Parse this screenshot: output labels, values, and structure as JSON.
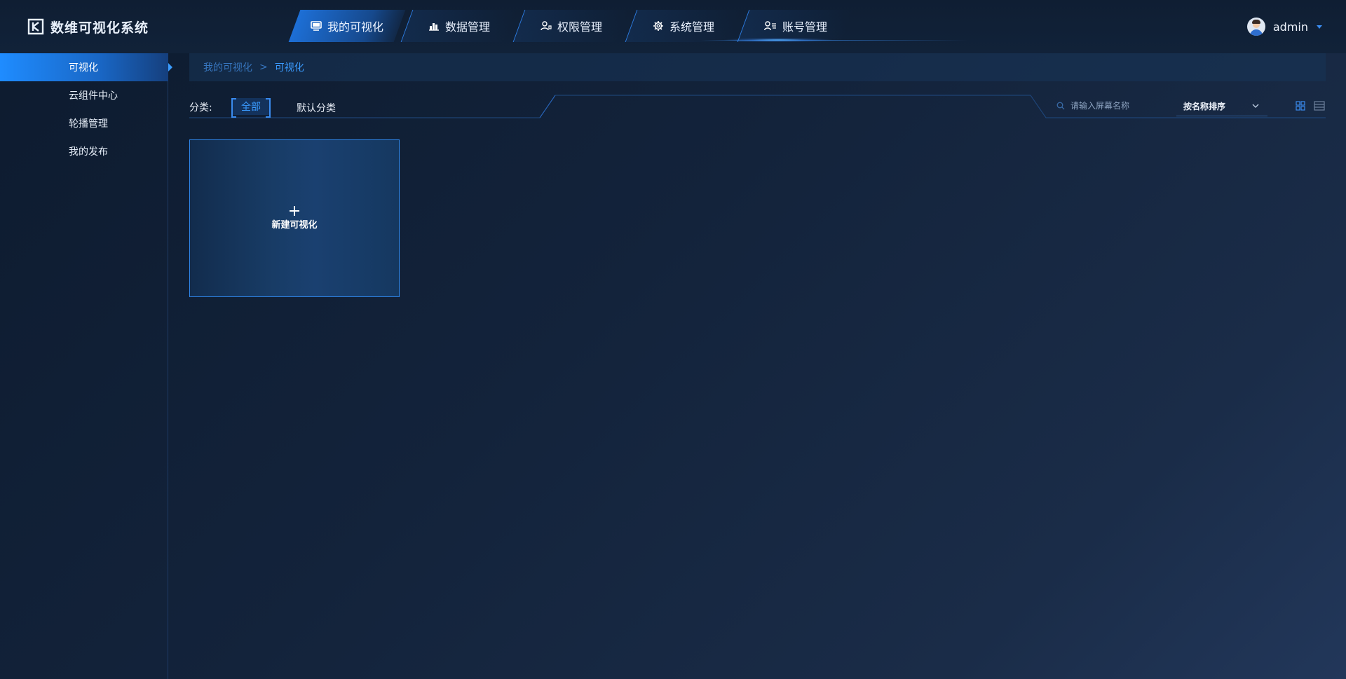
{
  "app": {
    "title": "数维可视化系统"
  },
  "nav": {
    "tabs": [
      {
        "label": "我的可视化",
        "icon": "monitor-icon",
        "active": true
      },
      {
        "label": "数据管理",
        "icon": "data-chart-icon",
        "active": false
      },
      {
        "label": "权限管理",
        "icon": "user-permission-icon",
        "active": false
      },
      {
        "label": "系统管理",
        "icon": "gear-icon",
        "active": false
      },
      {
        "label": "账号管理",
        "icon": "user-list-icon",
        "active": false
      }
    ]
  },
  "user": {
    "name": "admin"
  },
  "sidebar": {
    "items": [
      {
        "label": "可视化",
        "active": true
      },
      {
        "label": "云组件中心",
        "active": false
      },
      {
        "label": "轮播管理",
        "active": false
      },
      {
        "label": "我的发布",
        "active": false
      }
    ]
  },
  "breadcrumb": {
    "parent": "我的可视化",
    "separator": ">",
    "current": "可视化"
  },
  "filter": {
    "category_label": "分类:",
    "categories": [
      {
        "label": "全部",
        "selected": true
      },
      {
        "label": "默认分类",
        "selected": false
      }
    ],
    "search_placeholder": "请输入屏幕名称",
    "sort_label": "按名称排序"
  },
  "new_card": {
    "label": "新建可视化"
  },
  "colors": {
    "accent": "#3a9bff",
    "active_nav": "#1d6fd6",
    "border": "#2f86ea",
    "background": "#13233b"
  }
}
